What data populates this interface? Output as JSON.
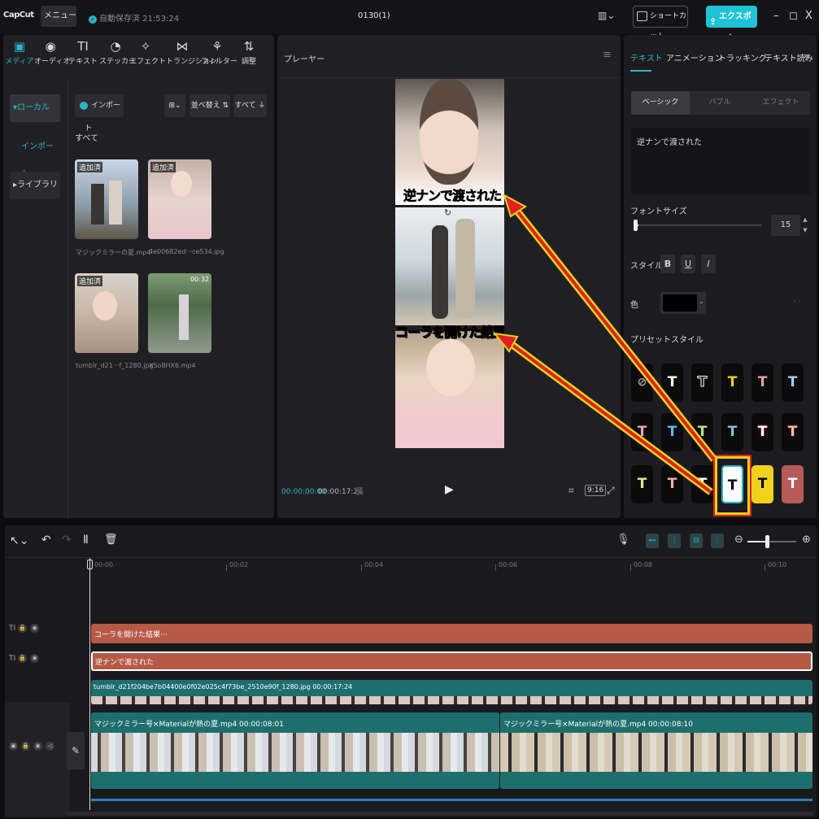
{
  "titlebar": {
    "logo": "CapCut",
    "menu": "メニュー",
    "autosave": "自動保存済 21:53:24",
    "project": "0130(1)",
    "shortcut": "ショートカット",
    "export": "エクスポート"
  },
  "media": {
    "tabs": [
      "メディア",
      "オーディオ",
      "テキスト",
      "ステッカー",
      "エフェクト",
      "トランジション",
      "フィルター",
      "調整"
    ],
    "tab_icons": [
      "▣",
      "◉",
      "TI",
      "◔",
      "✧",
      "⋈",
      "⚘",
      "⇅"
    ],
    "sidebar": [
      "▾ローカル",
      "インポート",
      "▸ライブラリ"
    ],
    "import_btn": "インポート",
    "sort_btn": "並べ替え",
    "all_btn": "すべて",
    "section": "すべて",
    "items": [
      {
        "badge": "追加済",
        "duration": "",
        "name": "マジックミラーの夏.mp4"
      },
      {
        "badge": "追加済",
        "duration": "",
        "name": "4e00682ed···ce534.jpg"
      },
      {
        "badge": "追加済",
        "duration": "",
        "name": "tumblr_d21···f_1280.jpg"
      },
      {
        "badge": "",
        "duration": "00:32",
        "name": "XSo8HX6.mp4"
      }
    ]
  },
  "player": {
    "title": "プレーヤー",
    "caption_top": "逆ナンで渡された",
    "caption_mid": "コーラを開けた結果",
    "time_current": "00:00:00:00",
    "time_total": "00:00:17:24",
    "ratio": "9:16"
  },
  "text_panel": {
    "tabs": [
      "テキスト",
      "アニメーション",
      "トラッキング",
      "テキスト読み"
    ],
    "modes": [
      "ベーシック",
      "バブル",
      "エフェクト"
    ],
    "content": "逆ナンで渡された",
    "font_size_label": "フォントサイズ",
    "font_size": "15",
    "style_label": "スタイル",
    "style_buttons": [
      "B",
      "U",
      "I"
    ],
    "color_label": "色",
    "preset_label": "プリセットスタイル",
    "preset_glyph": "T"
  },
  "timeline": {
    "ruler": [
      "00:00",
      "00:02",
      "00:04",
      "00:06",
      "00:08",
      "00:10"
    ],
    "text_clip_1": "コーラを開けた結果···",
    "text_clip_2": "逆ナンで渡された",
    "image_clip": "tumblr_d21f204be7b04400e0f02e025c4f73be_2510e90f_1280.jpg  00:00:17:24",
    "video_clip_1": "マジックミラー号×Materialが熱の夏.mp4  00:00:08:01",
    "video_clip_2": "マジックミラー号×Materialが熱の夏.mp4  00:00:08:10"
  },
  "colors": {
    "accent": "#2bb5c7",
    "text_clip": "#b65a45",
    "image_clip": "#1f6e6e",
    "highlight": "#e8d21a",
    "arrow_red": "#e02020"
  }
}
